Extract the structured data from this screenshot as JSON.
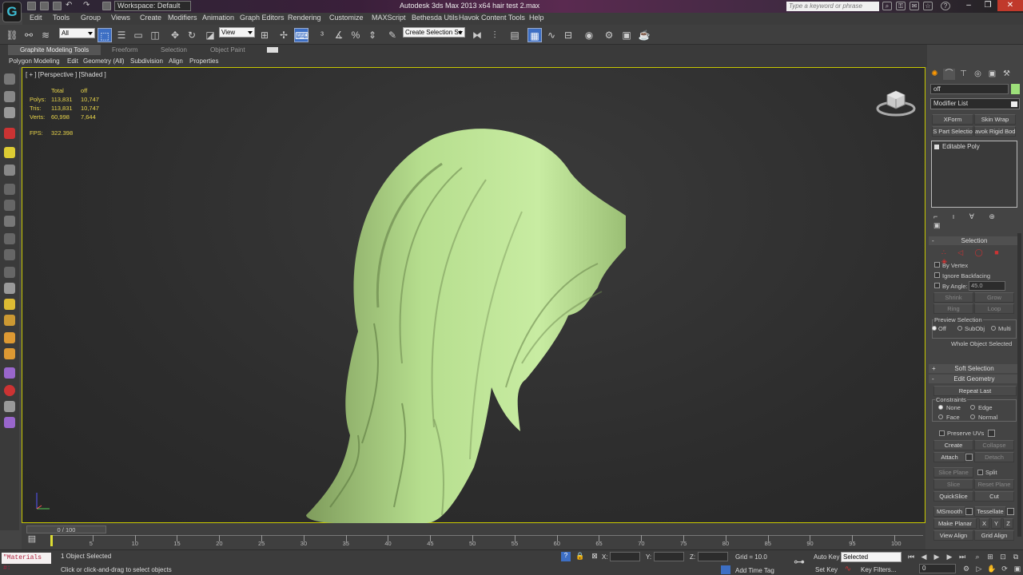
{
  "title_bar": {
    "workspace": "Workspace: Default",
    "app_title": "Autodesk 3ds Max  2013 x64       hair test 2.max",
    "search_placeholder": "Type a keyword or phrase"
  },
  "menu": [
    "Edit",
    "Tools",
    "Group",
    "Views",
    "Create",
    "Modifiers",
    "Animation",
    "Graph Editors",
    "Rendering",
    "Customize",
    "MAXScript",
    "Bethesda Utils",
    "Havok Content Tools",
    "Help"
  ],
  "toolbar": {
    "selection_filter": "All",
    "ref_coord": "View",
    "named_selection": "Create Selection Se"
  },
  "ribbon": {
    "tabs": [
      "Graphite Modeling Tools",
      "Freeform",
      "Selection",
      "Object Paint"
    ],
    "panels": [
      "Polygon Modeling",
      "Edit",
      "Geometry (All)",
      "Subdivision",
      "Align",
      "Properties"
    ]
  },
  "viewport": {
    "label": "[ + ] [Perspective ] [Shaded ]",
    "stats_header": [
      "Total",
      "off"
    ],
    "stats": [
      {
        "name": "Polys:",
        "total": "113,831",
        "sel": "10,747"
      },
      {
        "name": "Tris:",
        "total": "113,831",
        "sel": "10,747"
      },
      {
        "name": "Verts:",
        "total": "60,998",
        "sel": "7,644"
      }
    ],
    "fps_label": "FPS:",
    "fps": "322.398",
    "model_color": "#b6de8e"
  },
  "command_panel": {
    "object_name": "off",
    "modifier_list": "Modifier List",
    "mod_buttons": [
      "XForm",
      "Skin Wrap",
      "S Part Selectio",
      "avok Rigid Bod"
    ],
    "stack_item": "Editable Poly",
    "selection": {
      "header": "Selection",
      "by_vertex": "By Vertex",
      "ignore_backfacing": "Ignore Backfacing",
      "by_angle": "By Angle:",
      "angle_value": "45.0",
      "shrink": "Shrink",
      "grow": "Grow",
      "ring": "Ring",
      "loop": "Loop",
      "preview_label": "Preview Selection",
      "preview_options": [
        "Off",
        "SubObj",
        "Multi"
      ],
      "status": "Whole Object Selected"
    },
    "soft_selection": "Soft Selection",
    "edit_geometry": {
      "header": "Edit Geometry",
      "repeat_last": "Repeat Last",
      "constraints_label": "Constraints",
      "constraints": [
        "None",
        "Edge",
        "Face",
        "Normal"
      ],
      "preserve_uvs": "Preserve UVs",
      "create": "Create",
      "collapse": "Collapse",
      "attach": "Attach",
      "detach": "Detach",
      "slice_plane": "Slice Plane",
      "split": "Split",
      "slice": "Slice",
      "reset_plane": "Reset Plane",
      "quickslice": "QuickSlice",
      "cut": "Cut",
      "msmooth": "MSmooth",
      "tessellate": "Tessellate",
      "make_planar": "Make Planar",
      "x": "X",
      "y": "Y",
      "z": "Z",
      "view_align": "View Align",
      "grid_align": "Grid Align"
    }
  },
  "timeline": {
    "slider": "0 / 100",
    "ticks": [
      "5",
      "10",
      "15",
      "20",
      "25",
      "30",
      "35",
      "40",
      "45",
      "50",
      "55",
      "60",
      "65",
      "70",
      "75",
      "80",
      "85",
      "90",
      "95",
      "100"
    ]
  },
  "status": {
    "maxscript": "\"Materials #:",
    "objects_selected": "1 Object Selected",
    "prompt": "Click or click-and-drag to select objects",
    "x_label": "X:",
    "y_label": "Y:",
    "z_label": "Z:",
    "grid": "Grid = 10.0",
    "add_time_tag": "Add Time Tag",
    "auto_key": "Auto Key",
    "set_key": "Set Key",
    "key_mode": "Selected",
    "key_filters": "Key Filters...",
    "frame": "0"
  }
}
